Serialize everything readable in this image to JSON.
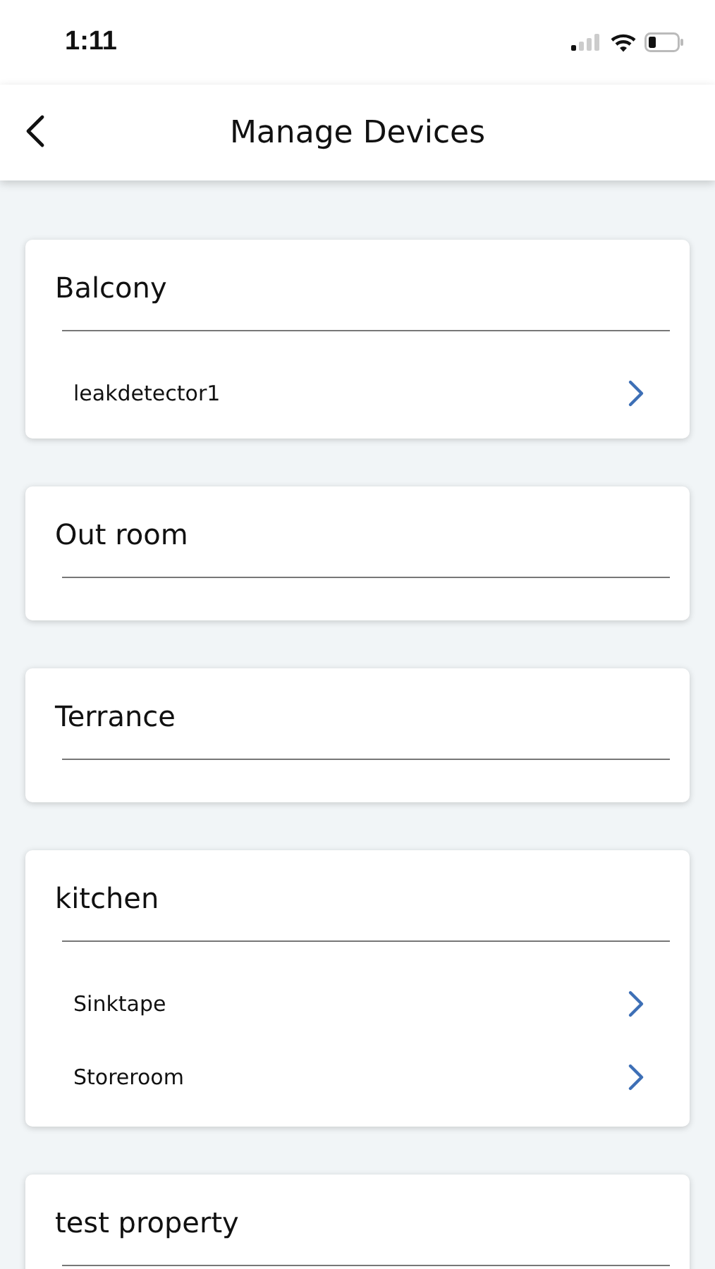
{
  "status_bar": {
    "time": "1:11"
  },
  "header": {
    "title": "Manage Devices"
  },
  "rooms": [
    {
      "name": "Balcony",
      "devices": [
        {
          "name": "leakdetector1"
        }
      ]
    },
    {
      "name": "Out room"
    },
    {
      "name": "Terrance"
    },
    {
      "name": "kitchen",
      "devices": [
        {
          "name": "Sinktape"
        },
        {
          "name": "Storeroom"
        }
      ]
    },
    {
      "name": "test property"
    }
  ]
}
